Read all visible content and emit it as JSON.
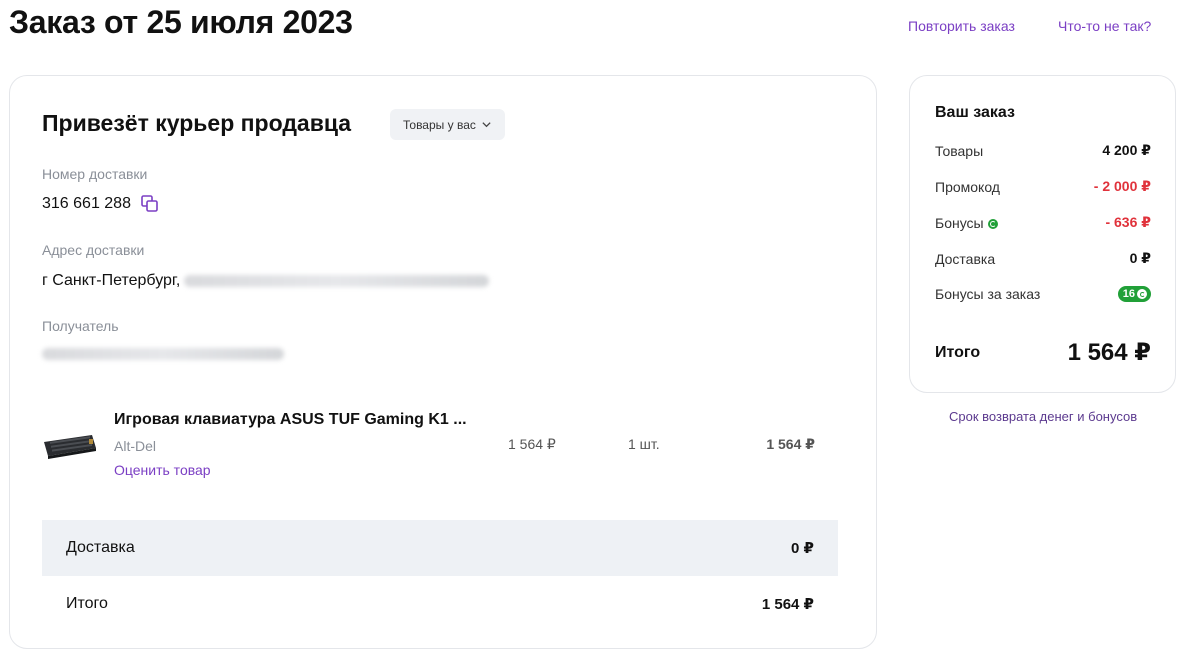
{
  "header": {
    "title": "Заказ от 25 июля 2023",
    "repeat_order": "Повторить заказ",
    "something_wrong": "Что-то не так?"
  },
  "delivery": {
    "heading": "Привезёт курьер продавца",
    "goods_toggle": "Товары у вас",
    "number_label": "Номер доставки",
    "number_value": "316 661 288",
    "address_label": "Адрес доставки",
    "address_value": "г Санкт-Петербург,",
    "recipient_label": "Получатель"
  },
  "product": {
    "name": "Игровая клавиатура ASUS TUF Gaming K1 ...",
    "seller": "Alt-Del",
    "rate_link": "Оценить товар",
    "price": "1 564 ₽",
    "quantity": "1 шт.",
    "total": "1 564 ₽"
  },
  "summary": {
    "delivery_label": "Доставка",
    "delivery_value": "0 ₽",
    "total_label": "Итого",
    "total_value": "1 564 ₽"
  },
  "side": {
    "title": "Ваш заказ",
    "goods_label": "Товары",
    "goods_value": "4 200 ₽",
    "promo_label": "Промокод",
    "promo_value": "- 2 000 ₽",
    "bonus_label": "Бонусы",
    "bonus_value": "- 636 ₽",
    "delivery_label": "Доставка",
    "delivery_value": "0 ₽",
    "bonus_earned_label": "Бонусы за заказ",
    "bonus_earned_value": "16",
    "total_label": "Итого",
    "total_value": "1 564 ₽",
    "refund_link": "Срок возврата денег и бонусов"
  },
  "colors": {
    "accent": "#7b3fc4",
    "negative": "#e0323b",
    "bonus_green": "#21a038"
  }
}
